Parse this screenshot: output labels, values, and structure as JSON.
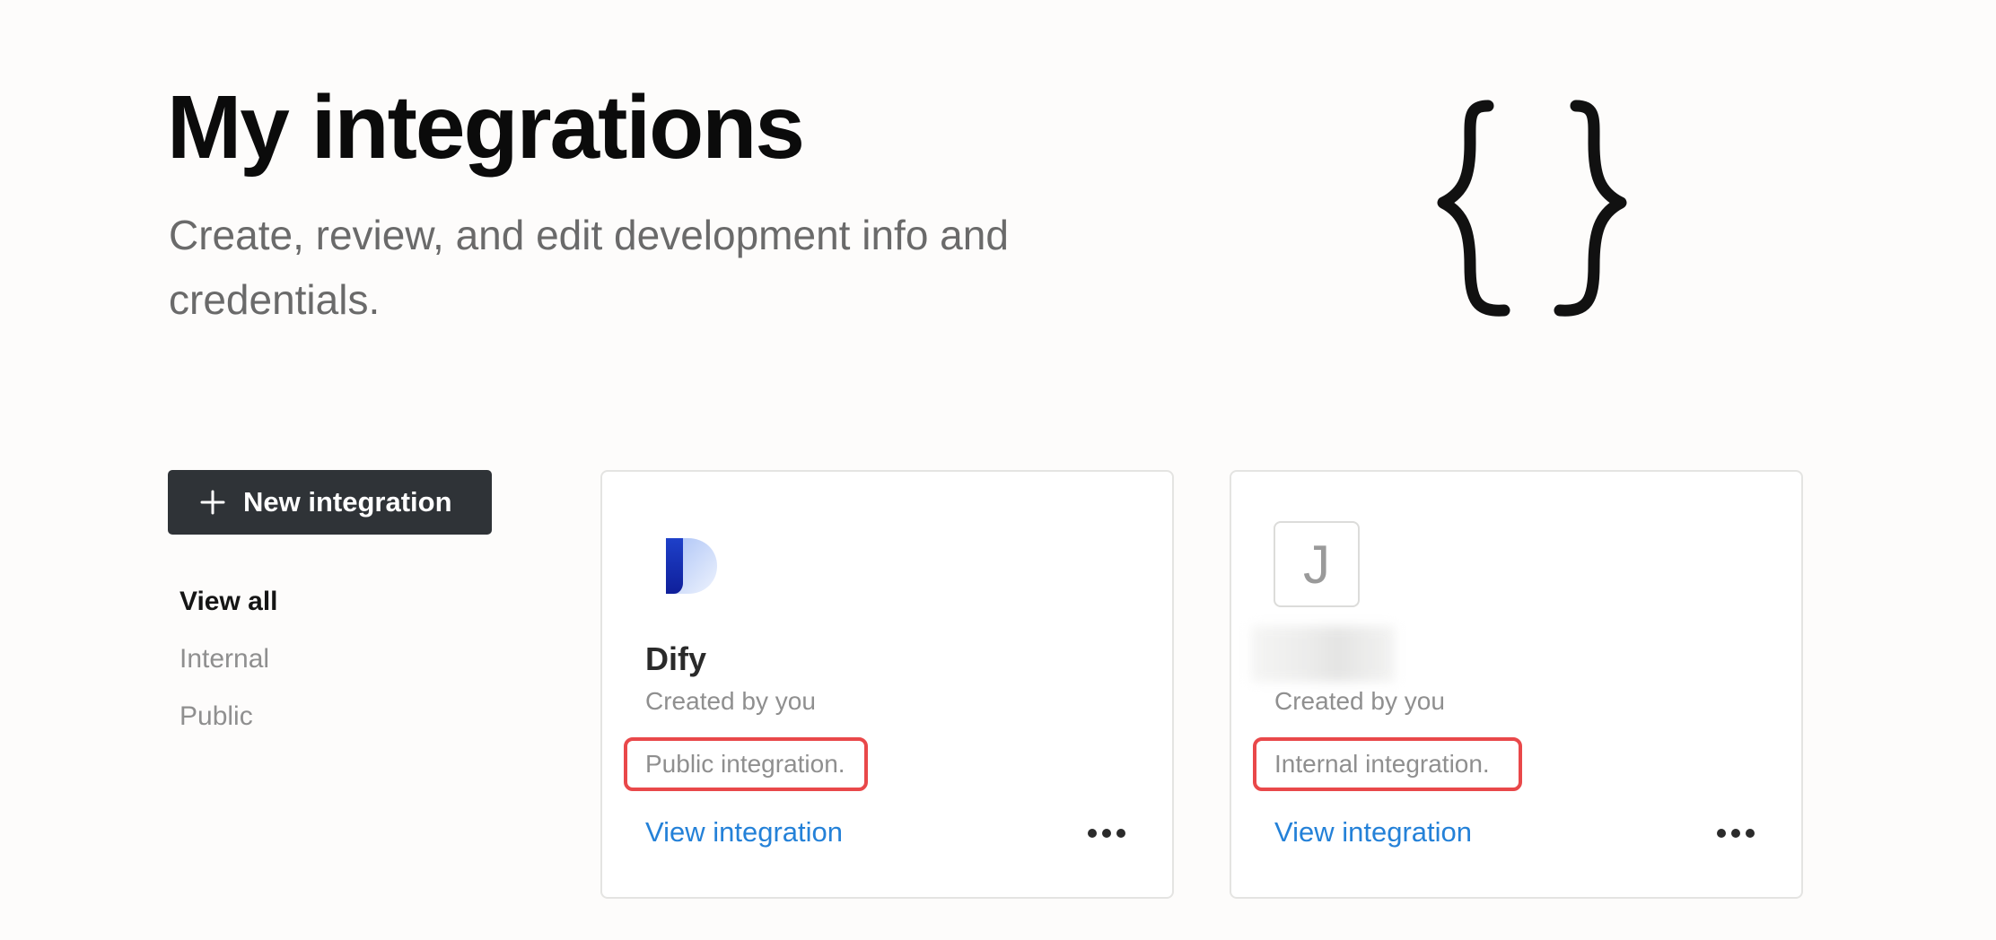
{
  "header": {
    "title": "My integrations",
    "subtitle": "Create, review, and edit development info and credentials."
  },
  "sidebar": {
    "new_button_label": "New integration",
    "nav_items": [
      {
        "label": "View all",
        "active": true
      },
      {
        "label": "Internal",
        "active": false
      },
      {
        "label": "Public",
        "active": false
      }
    ]
  },
  "cards": [
    {
      "name": "Dify",
      "icon": "dify-logo",
      "creator": "Created by you",
      "type": "Public integration.",
      "link": "View integration"
    },
    {
      "name": "",
      "icon_letter": "J",
      "creator": "Created by you",
      "type": "Internal integration.",
      "link": "View integration"
    }
  ],
  "colors": {
    "accent_link": "#2481d8",
    "highlight_border": "#e9484a",
    "button_bg": "#2f3337"
  }
}
